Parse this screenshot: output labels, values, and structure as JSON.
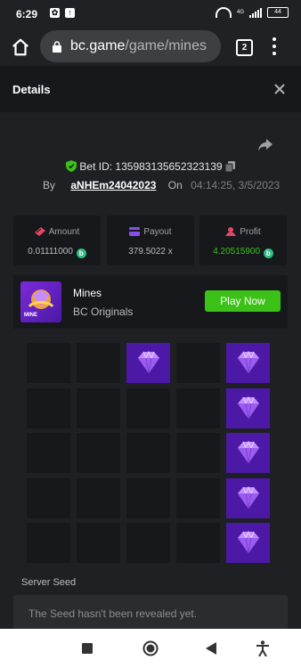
{
  "status_bar": {
    "time": "6:29",
    "battery": "44",
    "network": "4G"
  },
  "browser": {
    "url_host": "bc.game",
    "url_path": "/game/mines",
    "tab_count": "2"
  },
  "panel": {
    "title": "Details"
  },
  "bet": {
    "id_label": "Bet ID: 135983135652323139",
    "by_label": "By",
    "username": "aNHEm24042023",
    "on_label": "On",
    "datetime": "04:14:25, 3/5/2023"
  },
  "stats": {
    "amount_label": "Amount",
    "amount_value": "0.01111000",
    "payout_label": "Payout",
    "payout_value": "379.5022 x",
    "profit_label": "Profit",
    "profit_value": "4.20515900",
    "coin_symbol": "b",
    "profit_color": "#3bc117"
  },
  "game": {
    "thumb_text": "MINE",
    "name": "Mines",
    "provider": "BC Originals",
    "play_label": "Play Now",
    "play_color": "#3bc117"
  },
  "board": {
    "rows": 5,
    "cols": 5,
    "gem_color": "#4b19a6",
    "cells": [
      [
        false,
        false,
        true,
        false,
        true
      ],
      [
        false,
        false,
        false,
        false,
        true
      ],
      [
        false,
        false,
        false,
        false,
        true
      ],
      [
        false,
        false,
        false,
        false,
        true
      ],
      [
        false,
        false,
        false,
        false,
        true
      ]
    ]
  },
  "seed": {
    "label": "Server Seed",
    "text": "The Seed hasn't been revealed yet."
  },
  "icons": {
    "home": "home-icon",
    "lock": "lock-icon",
    "close": "close-icon",
    "share": "share-icon",
    "shield": "shield-icon",
    "copy": "copy-icon",
    "gem": "diamond-icon"
  }
}
